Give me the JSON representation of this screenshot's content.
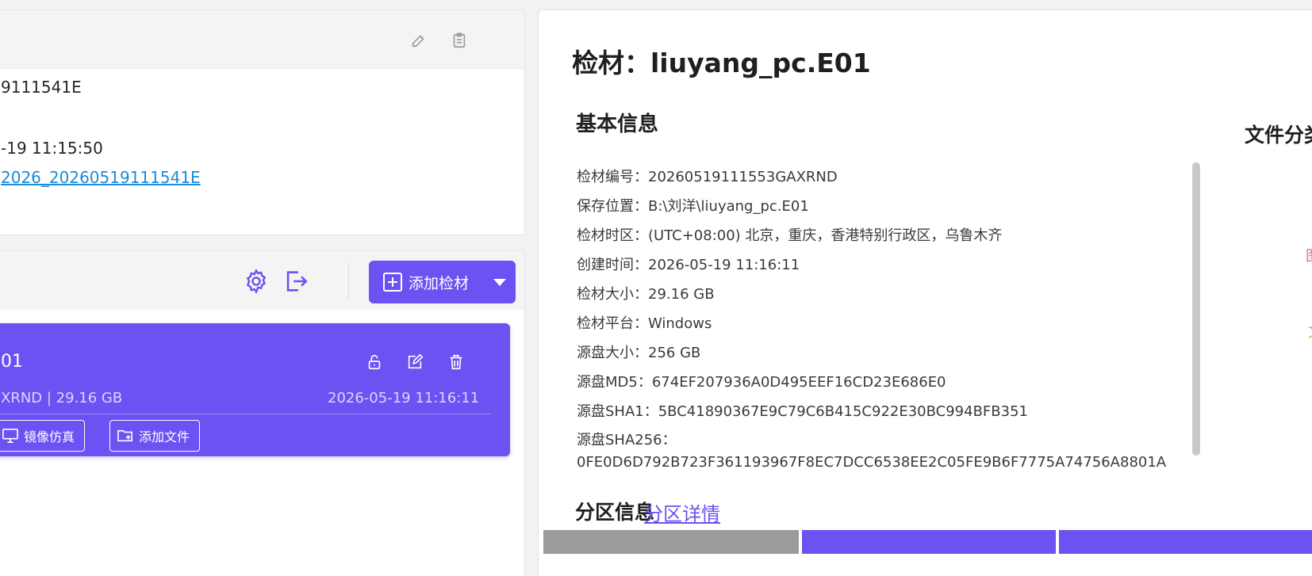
{
  "case_info": {
    "lines": [
      "9111541E",
      "-19 11:15:50"
    ],
    "link_text": "2026_20260519111541E"
  },
  "toolbar": {
    "add_evidence_label": "添加检材"
  },
  "evidence_card": {
    "title": "01",
    "meta_left": "XRND | 29.16 GB",
    "meta_right": "2026-05-19 11:16:11",
    "mirror_button": "镜像仿真",
    "add_file_button": "添加文件"
  },
  "detail": {
    "title": "检材：liuyang_pc.E01",
    "basic_info_heading": "基本信息",
    "file_class_heading": "文件分类",
    "fields": [
      {
        "label": "检材编号：",
        "value": "20260519111553GAXRND"
      },
      {
        "label": "保存位置：",
        "value": "B:\\刘洋\\liuyang_pc.E01"
      },
      {
        "label": "检材时区：",
        "value": "(UTC+08:00) 北京，重庆，香港特别行政区，乌鲁木齐"
      },
      {
        "label": "创建时间：",
        "value": "2026-05-19 11:16:11"
      },
      {
        "label": "检材大小：",
        "value": "29.16 GB"
      },
      {
        "label": "检材平台：",
        "value": "Windows"
      },
      {
        "label": "源盘大小：",
        "value": "256 GB"
      },
      {
        "label": "源盘MD5：",
        "value": "674EF207936A0D495EEF16CD23E686E0"
      },
      {
        "label": "源盘SHA1：",
        "value": "5BC41890367E9C79C6B415C922E30BC994BFB351"
      },
      {
        "label": "源盘SHA256：",
        "value": "0FE0D6D792B723F361193967F8EC7DCC6538EE2C05FE9B6F7775A74756A8801A"
      }
    ],
    "partition_heading": "分区信息",
    "partition_link": "分区详情",
    "edge_glyphs": [
      "图",
      "文"
    ],
    "colors": {
      "accent": "#6b52f2",
      "bar_gray": "#9b9b9b"
    }
  }
}
